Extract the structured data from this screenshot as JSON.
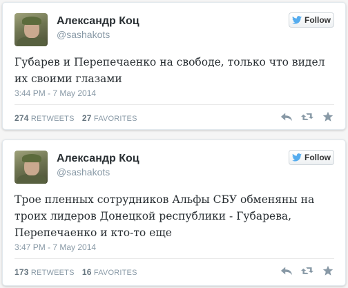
{
  "tweets": [
    {
      "fullname": "Александр Коц",
      "screenname": "@sashakots",
      "follow_label": "Follow",
      "text": "Губарев и Перепечаенко на свободе, только что видел их своими глазами",
      "timestamp": "3:44 PM - 7 May 2014",
      "retweets_count": "274",
      "retweets_label": "RETWEETS",
      "favorites_count": "27",
      "favorites_label": "FAVORITES"
    },
    {
      "fullname": "Александр Коц",
      "screenname": "@sashakots",
      "follow_label": "Follow",
      "text": "Трое пленных сотрудников Альфы СБУ обменяны на троих лидеров Донецкой республики - Губарева, Перепечаенко и кто-то еще",
      "timestamp": "3:47 PM - 7 May 2014",
      "retweets_count": "173",
      "retweets_label": "RETWEETS",
      "favorites_count": "16",
      "favorites_label": "FAVORITES"
    }
  ],
  "colors": {
    "brand_blue": "#55acee",
    "icon_gray": "#8899a6",
    "text_dark": "#292f33"
  },
  "icons": [
    "twitter-bird-icon",
    "reply-icon",
    "retweet-icon",
    "favorite-star-icon"
  ]
}
